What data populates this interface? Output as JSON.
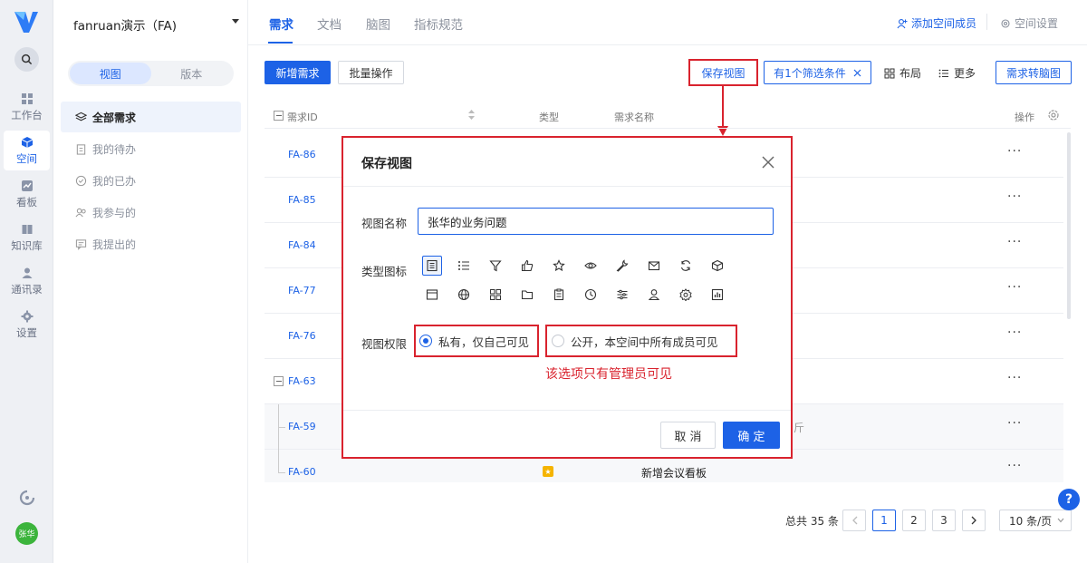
{
  "rail": {
    "items": [
      {
        "label": "工作台",
        "icon": "grid-icon"
      },
      {
        "label": "空间",
        "icon": "cube-icon"
      },
      {
        "label": "看板",
        "icon": "chart-icon"
      },
      {
        "label": "知识库",
        "icon": "book-icon"
      },
      {
        "label": "通讯录",
        "icon": "contact-icon"
      },
      {
        "label": "设置",
        "icon": "gear-icon"
      }
    ],
    "active_index": 1,
    "avatar": "张华"
  },
  "sidebar": {
    "workspace": "fanruan演示（FA)",
    "segments": [
      "视图",
      "版本"
    ],
    "items": [
      {
        "label": "全部需求",
        "icon": "layers-icon"
      },
      {
        "label": "我的待办",
        "icon": "clipboard-icon"
      },
      {
        "label": "我的已办",
        "icon": "check-circle-icon"
      },
      {
        "label": "我参与的",
        "icon": "users-icon"
      },
      {
        "label": "我提出的",
        "icon": "message-icon"
      }
    ]
  },
  "header": {
    "tabs": [
      "需求",
      "文档",
      "脑图",
      "指标规范"
    ],
    "add_member": "添加空间成员",
    "space_settings": "空间设置"
  },
  "toolbar": {
    "new": "新增需求",
    "batch": "批量操作",
    "save_view": "保存视图",
    "filter": "有1个筛选条件",
    "layout": "布局",
    "more": "更多",
    "to_mindmap": "需求转脑图"
  },
  "table": {
    "columns": {
      "id": "需求ID",
      "type": "类型",
      "name": "需求名称",
      "op": "操作"
    },
    "rows": [
      {
        "id": "FA-86",
        "type": "",
        "name": ""
      },
      {
        "id": "FA-85",
        "type": "",
        "name": ""
      },
      {
        "id": "FA-84",
        "type": "",
        "name": ""
      },
      {
        "id": "FA-77",
        "type": "",
        "name": ""
      },
      {
        "id": "FA-76",
        "type": "",
        "name": ""
      },
      {
        "id": "FA-63",
        "type": "",
        "name": ""
      },
      {
        "id": "FA-59",
        "type": "",
        "name": "斤"
      },
      {
        "id": "FA-60",
        "type": "star",
        "name": "新增会议看板"
      }
    ],
    "more": "···"
  },
  "pagination": {
    "total": "总共 35 条",
    "pages": [
      "1",
      "2",
      "3"
    ],
    "current": "1",
    "size": "10 条/页"
  },
  "modal": {
    "title": "保存视图",
    "name_label": "视图名称",
    "name_value": "张华的业务问题",
    "icon_label": "类型图标",
    "icons": [
      "doc-icon",
      "list-icon",
      "filter-icon",
      "thumbs-up-icon",
      "star-icon",
      "eye-icon",
      "wrench-icon",
      "mail-icon",
      "refresh-icon",
      "box-icon",
      "window-icon",
      "globe-icon",
      "apps-icon",
      "folder-icon",
      "clipboard-icon",
      "clock-icon",
      "sliders-icon",
      "user-icon",
      "settings-icon",
      "bar-chart-icon"
    ],
    "perm_label": "视图权限",
    "private_option": "私有，仅自己可见",
    "public_option": "公开，本空间中所有成员可见",
    "note": "该选项只有管理员可见",
    "cancel": "取 消",
    "confirm": "确 定"
  },
  "colors": {
    "accent": "#1d62e6",
    "annotation": "#d9232e"
  }
}
